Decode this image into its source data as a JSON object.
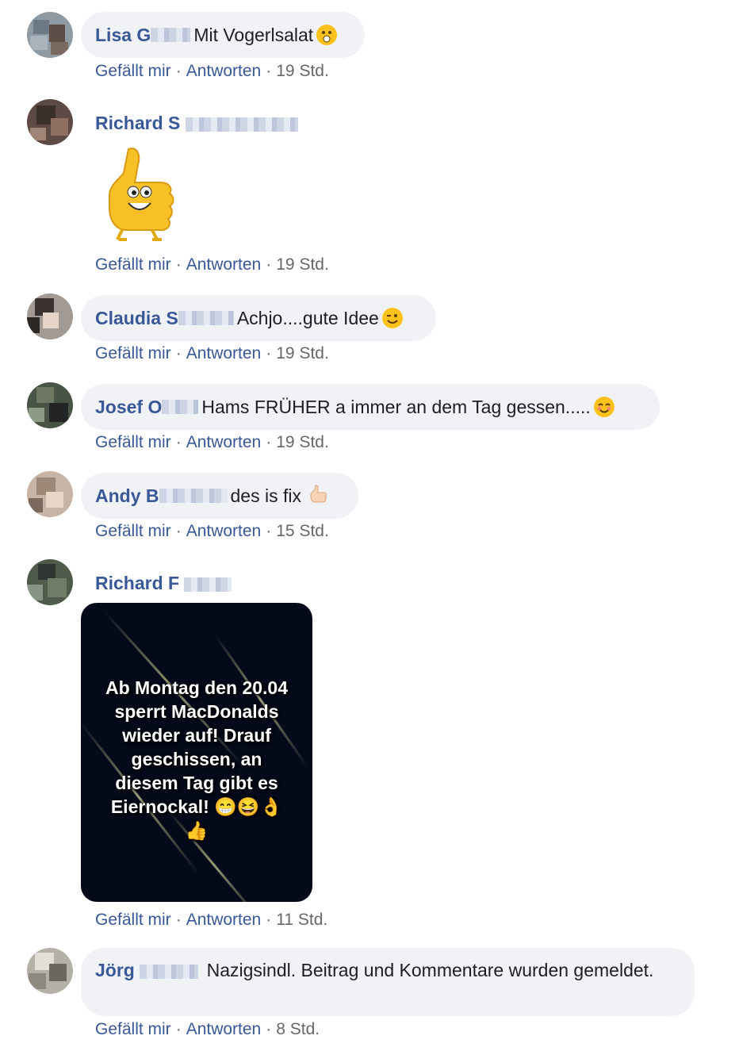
{
  "actions": {
    "like": "Gefällt mir",
    "reply": "Antworten",
    "separator": "·"
  },
  "comments": [
    {
      "author": "Lisa G",
      "text": "Mit Vogerlsalat",
      "time": "19 Std."
    },
    {
      "author": "Richard S",
      "text": "",
      "time": "19 Std."
    },
    {
      "author": "Claudia S",
      "text": "Achjo....gute Idee",
      "time": "19 Std."
    },
    {
      "author": "Josef O",
      "text": "Hams FRÜHER a immer an dem Tag gessen.....",
      "time": "19 Std."
    },
    {
      "author": "Andy B",
      "text": "des is fix",
      "time": "15 Std."
    },
    {
      "author": "Richard F",
      "text": "",
      "time": "11 Std."
    },
    {
      "author": "Jörg",
      "text": "Nazigsindl. Beitrag und Kommentare wurden gemeldet.",
      "time": "8 Std."
    }
  ],
  "image_post": {
    "lines": [
      "Ab Montag den 20.04",
      "sperrt MacDonalds",
      "wieder auf! Drauf",
      "geschissen, an",
      "diesem Tag gibt es",
      "Eiernockal! 😁😆👌",
      "👍"
    ]
  },
  "icons": {
    "c1": "astonished-emoji-icon",
    "c2": "thumbs-up-sticker-icon",
    "c3": "winking-face-emoji-icon",
    "c4": "smiling-face-emoji-icon",
    "c5": "thumbs-up-emoji-icon"
  },
  "colors": {
    "link": "#385898",
    "bubble": "#f0f2f5",
    "muted": "#65676b"
  }
}
